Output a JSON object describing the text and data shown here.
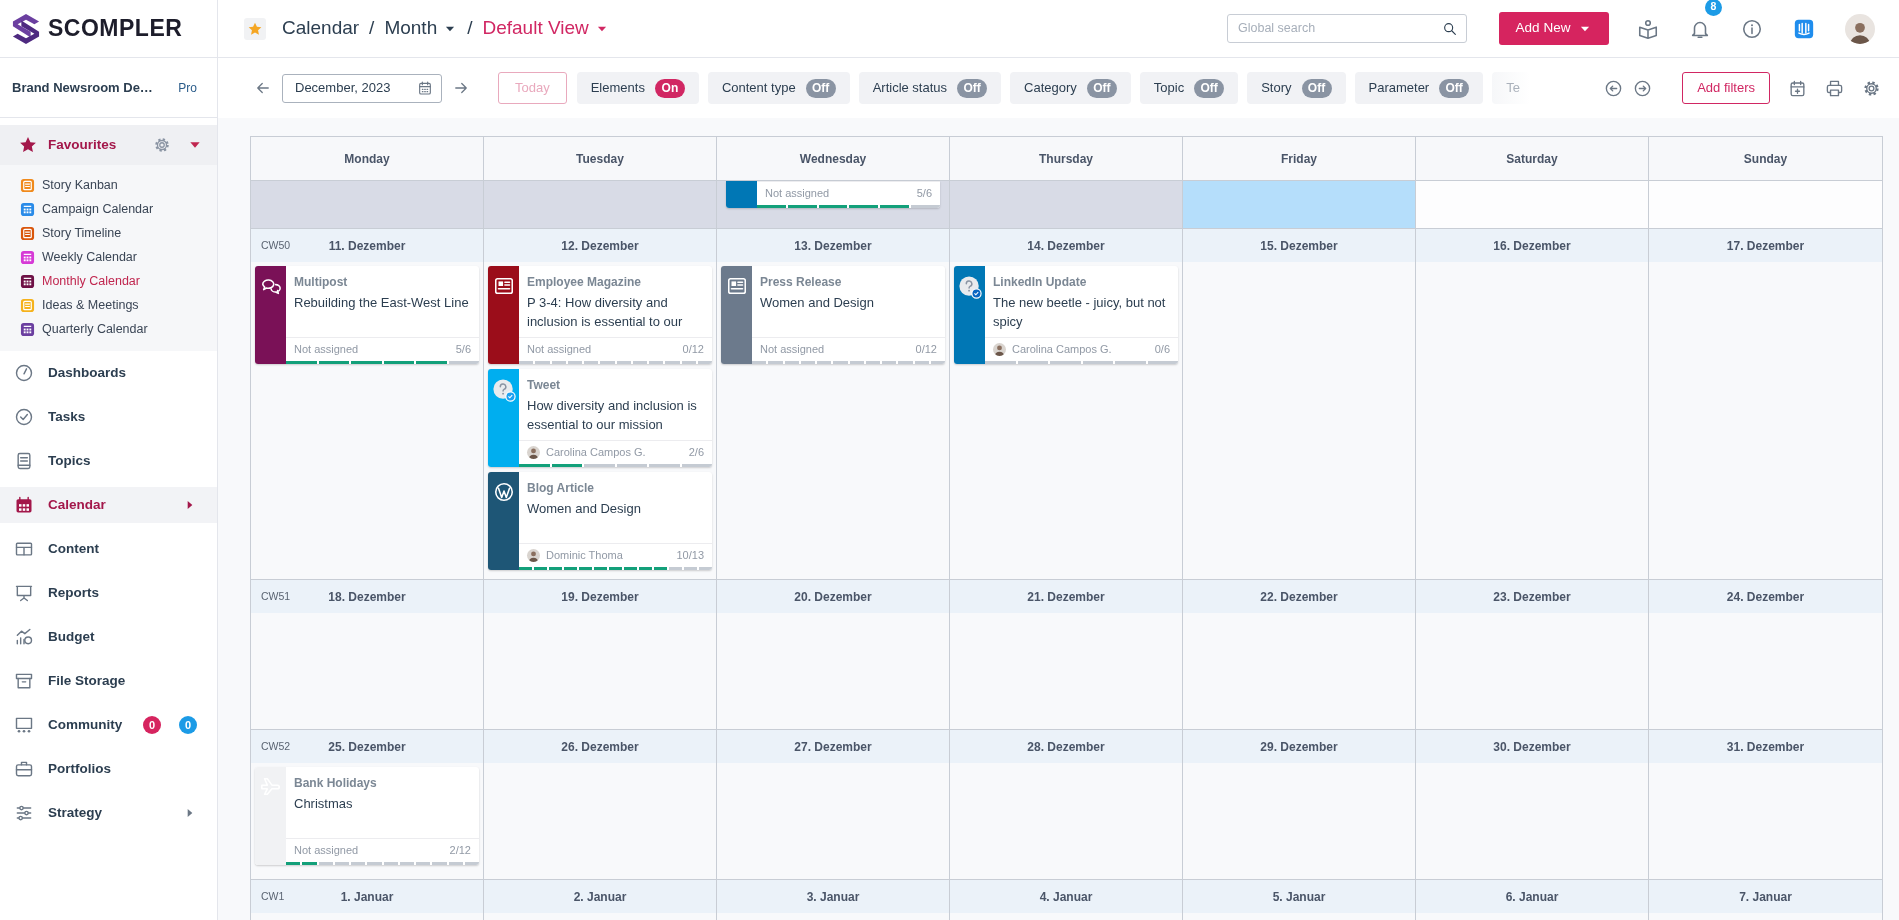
{
  "brand": {
    "name": "SCOMPLER"
  },
  "workspace": {
    "name": "Brand Newsroom De…",
    "plan": "Pro"
  },
  "favourites": {
    "label": "Favourites",
    "expanded": true,
    "items": [
      {
        "label": "Story Kanban",
        "kind": "board",
        "color": "#f08a1c",
        "selected": false
      },
      {
        "label": "Campaign Calendar",
        "kind": "calendar",
        "color": "#2a8be8",
        "selected": false
      },
      {
        "label": "Story Timeline",
        "kind": "board",
        "color": "#d9560c",
        "selected": false
      },
      {
        "label": "Weekly Calendar",
        "kind": "calendar",
        "color": "#d63ad6",
        "selected": false
      },
      {
        "label": "Monthly Calendar",
        "kind": "calendar",
        "color": "#6e1146",
        "selected": true
      },
      {
        "label": "Ideas & Meetings",
        "kind": "board",
        "color": "#f5b21c",
        "selected": false
      },
      {
        "label": "Quarterly Calendar",
        "kind": "calendar",
        "color": "#6b3fa0",
        "selected": false
      }
    ]
  },
  "nav": [
    {
      "label": "Dashboards",
      "kind": "gauge",
      "selected": false,
      "submenu": false
    },
    {
      "label": "Tasks",
      "kind": "check",
      "selected": false,
      "submenu": false
    },
    {
      "label": "Topics",
      "kind": "book",
      "selected": false,
      "submenu": false
    },
    {
      "label": "Calendar",
      "kind": "calendar",
      "selected": true,
      "submenu": true
    },
    {
      "label": "Content",
      "kind": "table",
      "selected": false,
      "submenu": false
    },
    {
      "label": "Reports",
      "kind": "presentation",
      "selected": false,
      "submenu": false
    },
    {
      "label": "Budget",
      "kind": "budget",
      "selected": false,
      "submenu": false
    },
    {
      "label": "File Storage",
      "kind": "archive",
      "selected": false,
      "submenu": false
    },
    {
      "label": "Community",
      "kind": "community",
      "selected": false,
      "submenu": false,
      "badges": [
        {
          "text": "0",
          "color": "#d6245f"
        },
        {
          "text": "0",
          "color": "#1c9be6"
        }
      ]
    },
    {
      "label": "Portfolios",
      "kind": "briefcase",
      "selected": false,
      "submenu": false
    },
    {
      "label": "Strategy",
      "kind": "sliders",
      "selected": false,
      "submenu": true
    }
  ],
  "header": {
    "favourite": true,
    "separator": "/",
    "breadcrumb": [
      {
        "label": "Calendar",
        "kind": "plain"
      },
      {
        "label": "Month",
        "kind": "dropdown"
      },
      {
        "label": "Default View",
        "kind": "current"
      }
    ],
    "search": {
      "placeholder": "Global search"
    },
    "add_button": "Add New",
    "notifications": "8"
  },
  "toolbar": {
    "date": "December, 2023",
    "today": "Today",
    "today_disabled": true,
    "add_filters": "Add filters",
    "filters": [
      {
        "label": "Elements",
        "on": true,
        "toggle": "On",
        "clipped": false
      },
      {
        "label": "Content type",
        "on": false,
        "toggle": "Off",
        "clipped": false
      },
      {
        "label": "Article status",
        "on": false,
        "toggle": "Off",
        "clipped": false
      },
      {
        "label": "Category",
        "on": false,
        "toggle": "Off",
        "clipped": false
      },
      {
        "label": "Topic",
        "on": false,
        "toggle": "Off",
        "clipped": false
      },
      {
        "label": "Story",
        "on": false,
        "toggle": "Off",
        "clipped": false
      },
      {
        "label": "Parameter",
        "on": false,
        "toggle": "Off",
        "clipped": false
      },
      {
        "label": "Te",
        "clipped": true
      }
    ]
  },
  "calendar": {
    "weekdays": [
      "Monday",
      "Tuesday",
      "Wednesday",
      "Thursday",
      "Friday",
      "Saturday",
      "Sunday"
    ],
    "weeks": [
      {
        "kind": "tail",
        "days": [
          {
            "past": true,
            "today": false
          },
          {
            "past": true,
            "today": false
          },
          {
            "past": true,
            "today": false,
            "cards": [
              {
                "partial": true,
                "color": "#0077b5",
                "assignee": "Not assigned",
                "avatar": false,
                "count": "5/6",
                "steps": [
                  true,
                  true,
                  true,
                  true,
                  true,
                  false
                ]
              }
            ]
          },
          {
            "past": true,
            "today": false
          },
          {
            "past": false,
            "today": true
          },
          {
            "past": false,
            "today": false
          },
          {
            "past": false,
            "today": false
          }
        ]
      },
      {
        "kind": "full",
        "cw": "CW50",
        "days": [
          {
            "date": "11. Dezember",
            "past": false,
            "today": false,
            "cards": [
              {
                "partial": false,
                "kind": "multipost",
                "color": "#7a1157",
                "type": "Multipost",
                "title": "Rebuilding the East-West Line",
                "assignee": "Not assigned",
                "avatar": false,
                "count": "5/6",
                "steps": [
                  true,
                  true,
                  true,
                  true,
                  true,
                  false
                ]
              }
            ]
          },
          {
            "date": "12. Dezember",
            "past": false,
            "today": false,
            "cards": [
              {
                "partial": false,
                "kind": "magazine",
                "color": "#9b0d1a",
                "type": "Employee Magazine",
                "title": "P 3-4: How diversity and inclusion is essential to our",
                "assignee": "Not assigned",
                "avatar": false,
                "count": "0/12",
                "steps": [
                  false,
                  false,
                  false,
                  false,
                  false,
                  false,
                  false,
                  false,
                  false,
                  false,
                  false,
                  false
                ]
              },
              {
                "partial": false,
                "kind": "tweet",
                "color": "#00aeef",
                "type": "Tweet",
                "title": "How diversity and inclusion is essential to our mission",
                "assignee": "Carolina Campos G.",
                "avatar": true,
                "count": "2/6",
                "steps": [
                  true,
                  true,
                  false,
                  false,
                  false,
                  false
                ]
              },
              {
                "partial": false,
                "kind": "blog",
                "color": "#1e5676",
                "type": "Blog Article",
                "title": "Women and Design",
                "assignee": "Dominic Thoma",
                "avatar": true,
                "count": "10/13",
                "steps": [
                  true,
                  true,
                  true,
                  true,
                  true,
                  true,
                  true,
                  true,
                  true,
                  true,
                  false,
                  false,
                  false
                ]
              }
            ]
          },
          {
            "date": "13. Dezember",
            "past": false,
            "today": false,
            "cards": [
              {
                "partial": false,
                "kind": "magazine",
                "color": "#6c7a8c",
                "type": "Press Release",
                "title": "Women and Design",
                "assignee": "Not assigned",
                "avatar": false,
                "count": "0/12",
                "steps": [
                  false,
                  false,
                  false,
                  false,
                  false,
                  false,
                  false,
                  false,
                  false,
                  false,
                  false,
                  false
                ]
              }
            ]
          },
          {
            "date": "14. Dezember",
            "past": false,
            "today": false,
            "cards": [
              {
                "partial": false,
                "kind": "linkedin",
                "color": "#0077b5",
                "type": "LinkedIn Update",
                "title": "The new beetle - juicy, but not spicy",
                "assignee": "Carolina Campos G.",
                "avatar": true,
                "count": "0/6",
                "steps": [
                  false,
                  false,
                  false,
                  false,
                  false,
                  false
                ]
              }
            ]
          },
          {
            "date": "15. Dezember",
            "past": false,
            "today": false
          },
          {
            "date": "16. Dezember",
            "past": false,
            "today": false
          },
          {
            "date": "17. Dezember",
            "past": false,
            "today": false
          }
        ]
      },
      {
        "kind": "full",
        "cw": "CW51",
        "days": [
          {
            "date": "18. Dezember",
            "past": false,
            "today": false
          },
          {
            "date": "19. Dezember",
            "past": false,
            "today": false
          },
          {
            "date": "20. Dezember",
            "past": false,
            "today": false
          },
          {
            "date": "21. Dezember",
            "past": false,
            "today": false
          },
          {
            "date": "22. Dezember",
            "past": false,
            "today": false
          },
          {
            "date": "23. Dezember",
            "past": false,
            "today": false
          },
          {
            "date": "24. Dezember",
            "past": false,
            "today": false
          }
        ]
      },
      {
        "kind": "full",
        "cw": "CW52",
        "days": [
          {
            "date": "25. Dezember",
            "past": false,
            "today": false,
            "cards": [
              {
                "partial": false,
                "kind": "holiday",
                "color": "#f1f2f4",
                "type": "Bank Holidays",
                "title": "Christmas",
                "assignee": "Not assigned",
                "avatar": false,
                "count": "2/12",
                "steps": [
                  true,
                  true,
                  false,
                  false,
                  false,
                  false,
                  false,
                  false,
                  false,
                  false,
                  false,
                  false
                ]
              }
            ]
          },
          {
            "date": "26. Dezember",
            "past": false,
            "today": false
          },
          {
            "date": "27. Dezember",
            "past": false,
            "today": false
          },
          {
            "date": "28. Dezember",
            "past": false,
            "today": false
          },
          {
            "date": "29. Dezember",
            "past": false,
            "today": false
          },
          {
            "date": "30. Dezember",
            "past": false,
            "today": false
          },
          {
            "date": "31. Dezember",
            "past": false,
            "today": false
          }
        ]
      },
      {
        "kind": "full",
        "cw": "CW1",
        "days": [
          {
            "date": "1. Januar",
            "past": false,
            "today": false
          },
          {
            "date": "2. Januar",
            "past": false,
            "today": false
          },
          {
            "date": "3. Januar",
            "past": false,
            "today": false
          },
          {
            "date": "4. Januar",
            "past": false,
            "today": false
          },
          {
            "date": "5. Januar",
            "past": false,
            "today": false
          },
          {
            "date": "6. Januar",
            "past": false,
            "today": false
          },
          {
            "date": "7. Januar",
            "past": false,
            "today": false
          }
        ]
      }
    ]
  }
}
